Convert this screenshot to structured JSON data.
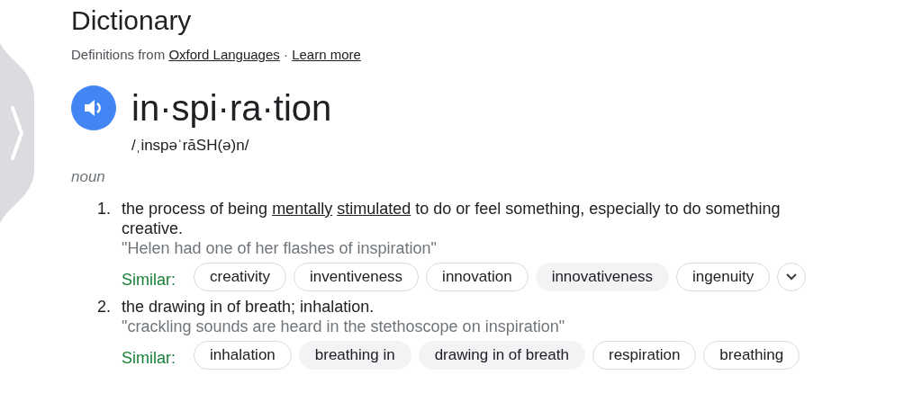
{
  "title": "Dictionary",
  "source": {
    "prefix": "Definitions from ",
    "source_link": "Oxford Languages",
    "separator": " · ",
    "learn_more": "Learn more"
  },
  "entry": {
    "word": "in·spi·ra·tion",
    "pronunciation": "/ˌinspəˈrāSH(ə)n/",
    "part_of_speech": "noun"
  },
  "senses": [
    {
      "number": "1.",
      "definition": [
        {
          "text": "the process of being",
          "kind": "text"
        },
        {
          "text": "mentally",
          "kind": "link"
        },
        {
          "text": "stimulated",
          "kind": "link"
        },
        {
          "text": "to do or feel something, especially to do something creative.",
          "kind": "text"
        }
      ],
      "example": "\"Helen had one of her flashes of inspiration\"",
      "similar_label": "Similar:",
      "similar": [
        {
          "text": "creativity",
          "filled": false
        },
        {
          "text": "inventiveness",
          "filled": false
        },
        {
          "text": "innovation",
          "filled": false
        },
        {
          "text": "innovativeness",
          "filled": true
        },
        {
          "text": "ingenuity",
          "filled": false
        }
      ],
      "more": true
    },
    {
      "number": "2.",
      "definition": [
        {
          "text": "the drawing in of breath; inhalation.",
          "kind": "text"
        }
      ],
      "example": "\"crackling sounds are heard in the stethoscope on inspiration\"",
      "similar_label": "Similar:",
      "similar": [
        {
          "text": "inhalation",
          "filled": false
        },
        {
          "text": "breathing in",
          "filled": true
        },
        {
          "text": "drawing in of breath",
          "filled": true
        },
        {
          "text": "respiration",
          "filled": false
        },
        {
          "text": "breathing",
          "filled": false
        }
      ],
      "more": false
    }
  ]
}
